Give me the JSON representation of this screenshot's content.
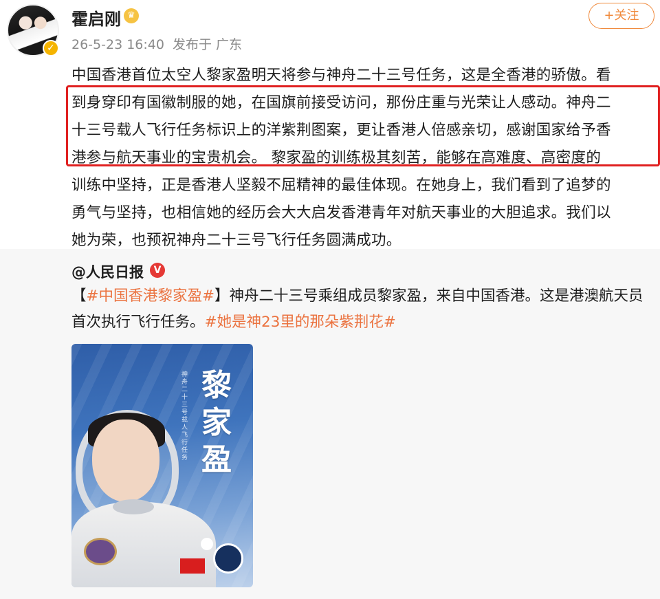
{
  "post": {
    "username": "霍启刚",
    "timestamp": "26-5-23 16:40",
    "published_in": "发布于 广东",
    "follow_label": "+关注",
    "lines": [
      "中国香港首位太空人黎家盈明天将参与神舟二十三号任务，这是全香港的骄傲。看",
      "到身穿印有国徽制服的她，在国旗前接受访问，那份庄重与光荣让人感动。神舟二",
      "十三号载人飞行任务标识上的洋紫荆图案，更让香港人倍感亲切，感谢国家给予香",
      "港参与航天事业的宝贵机会。 黎家盈的训练极其刻苦，能够在高难度、高密度的",
      "训练中坚持，正是香港人坚毅不屈精神的最佳体现。在她身上，我们看到了追梦的",
      "勇气与坚持，也相信她的经历会大大启发香港青年对航天事业的大胆追求。我们以",
      "她为荣，也预祝神舟二十三号飞行任务圆满成功。"
    ]
  },
  "repost": {
    "author": "@人民日报",
    "line1_open": "【",
    "hashtag1": "#中国香港黎家盈#",
    "line1_rest": "】神舟二十三号乘组成员黎家盈，来自中国香港。这是港澳航天员",
    "line2_text": "首次执行飞行任务。",
    "hashtag2": "#她是神23里的那朵紫荆花#",
    "poster_title": "黎家盈",
    "poster_subtitle": "神舟二十三号载人飞行任务"
  },
  "icons": {
    "verified": "verified-badge-icon",
    "vip": "vip-crown-icon",
    "repost_verified": "red-verified-icon"
  },
  "colors": {
    "accent": "#f08a3c",
    "hashtag": "#eb7340",
    "highlight_box": "#e02020"
  }
}
